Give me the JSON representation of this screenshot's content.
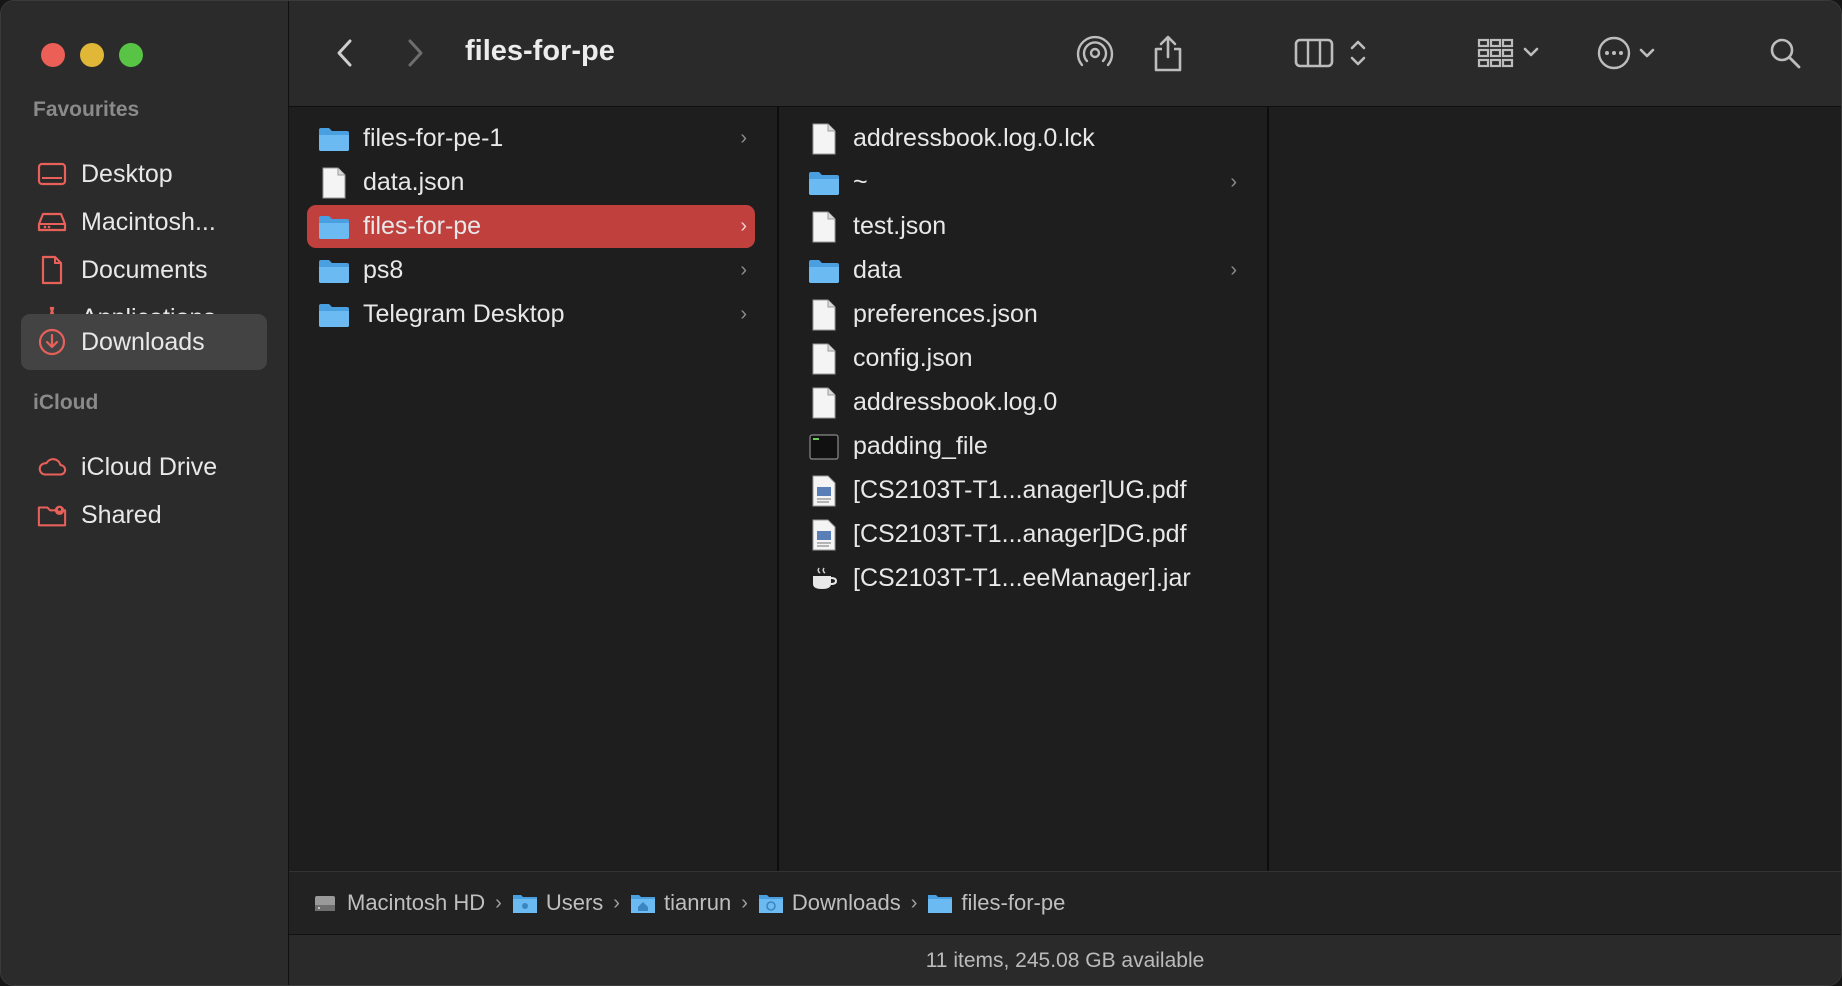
{
  "window": {
    "title": "files-for-pe"
  },
  "sidebar": {
    "sections": [
      {
        "title": "Favourites",
        "items": [
          {
            "label": "Desktop",
            "icon": "desktop-icon"
          },
          {
            "label": "Macintosh...",
            "icon": "hard-drive-icon"
          },
          {
            "label": "Documents",
            "icon": "document-icon"
          },
          {
            "label": "Applications",
            "icon": "applications-icon"
          },
          {
            "label": "Downloads",
            "icon": "download-icon",
            "active": true
          }
        ]
      },
      {
        "title": "iCloud",
        "items": [
          {
            "label": "iCloud Drive",
            "icon": "cloud-icon"
          },
          {
            "label": "Shared",
            "icon": "shared-folder-icon"
          }
        ]
      }
    ]
  },
  "columns": [
    {
      "items": [
        {
          "name": "files-for-pe-1",
          "type": "folder",
          "has_children": true
        },
        {
          "name": "data.json",
          "type": "file"
        },
        {
          "name": "files-for-pe",
          "type": "folder",
          "has_children": true,
          "selected": true
        },
        {
          "name": "ps8",
          "type": "folder",
          "has_children": true
        },
        {
          "name": "Telegram Desktop",
          "type": "folder",
          "has_children": true
        }
      ]
    },
    {
      "items": [
        {
          "name": "addressbook.log.0.lck",
          "type": "file"
        },
        {
          "name": "~",
          "type": "folder",
          "has_children": true
        },
        {
          "name": "test.json",
          "type": "file"
        },
        {
          "name": "data",
          "type": "folder",
          "has_children": true
        },
        {
          "name": "preferences.json",
          "type": "file"
        },
        {
          "name": "config.json",
          "type": "file"
        },
        {
          "name": "addressbook.log.0",
          "type": "file"
        },
        {
          "name": "padding_file",
          "type": "exec"
        },
        {
          "name": "[CS2103T-T1...anager]UG.pdf",
          "type": "pdf"
        },
        {
          "name": "[CS2103T-T1...anager]DG.pdf",
          "type": "pdf"
        },
        {
          "name": "[CS2103T-T1...eeManager].jar",
          "type": "jar"
        }
      ]
    }
  ],
  "pathbar": [
    {
      "label": "Macintosh HD",
      "icon": "hard-drive-icon"
    },
    {
      "label": "Users",
      "icon": "folder-icon"
    },
    {
      "label": "tianrun",
      "icon": "home-folder-icon"
    },
    {
      "label": "Downloads",
      "icon": "downloads-folder-icon"
    },
    {
      "label": "files-for-pe",
      "icon": "folder-icon"
    }
  ],
  "status": {
    "text": "11 items, 245.08 GB available"
  },
  "colors": {
    "accent": "#c0403e",
    "sidebar_icon": "#e8605a",
    "folder": "#5aaeea"
  }
}
